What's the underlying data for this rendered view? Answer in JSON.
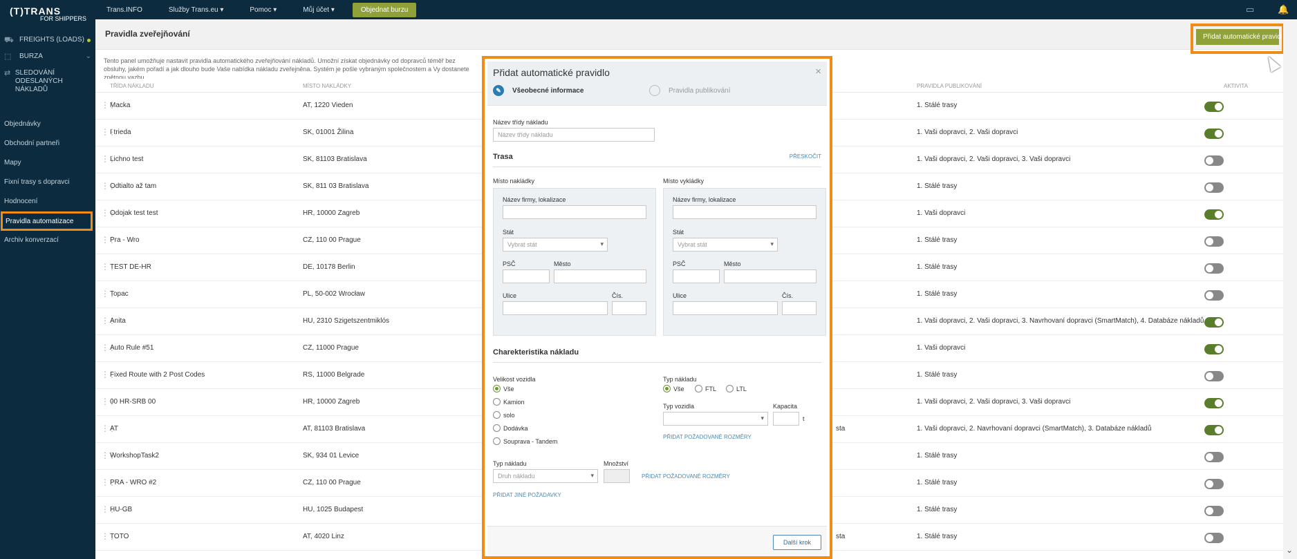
{
  "logo": {
    "line1": "(T)TRANS",
    "line2": "FOR SHIPPERS"
  },
  "sidebar": {
    "main": [
      {
        "label": "FREIGHTS (LOADS)",
        "icon": "freight-icon",
        "dot": true
      },
      {
        "label": "BURZA",
        "icon": "exchange-icon",
        "chevron": true
      },
      {
        "label": "SLEDOVÁNÍ ODESLANÝCH NÁKLADŮ",
        "icon": "tracking-icon"
      }
    ],
    "items": [
      {
        "label": "Objednávky"
      },
      {
        "label": "Obchodní partneři"
      },
      {
        "label": "Mapy"
      },
      {
        "label": "Fixní trasy s dopravci"
      },
      {
        "label": "Hodnocení"
      },
      {
        "label": "Pravidla automatizace",
        "active": true
      },
      {
        "label": "Archiv konverzací"
      }
    ]
  },
  "topbar": {
    "nav": [
      "Trans.INFO",
      "Služby Trans.eu ▾",
      "Pomoc ▾",
      "Můj účet ▾"
    ],
    "order_button": "Objednat burzu"
  },
  "page": {
    "title": "Pravidla zveřejňování",
    "add_button": "Přidat automatické pravidlo",
    "description": "Tento panel umožňuje nastavit pravidla automatického zveřejňování nákladů. Umožní získat objednávky od dopravců téměř bez obsluhy, jakém pořadí a jak dlouho bude Vaše nabídka nákladu zveřejněna. Systém je pošle vybraným společnostem a Vy dostanete zpětnou vazbu",
    "columns": {
      "class": "TŘÍDA NÁKLADU",
      "place": "MÍSTO NAKLÁDKY",
      "rules": "PRAVIDLA PUBLIKOVÁNÍ",
      "activity": "AKTIVITA"
    }
  },
  "rows": [
    {
      "name": "Macka",
      "place": "AT, 1220 Vieden",
      "rules": "1. Stálé trasy",
      "extra": "",
      "active": true
    },
    {
      "name": "I trieda",
      "place": "SK, 01001 Žilina",
      "rules": "1. Vaši dopravci, 2. Vaši dopravci",
      "extra": "",
      "active": true
    },
    {
      "name": "Lichno test",
      "place": "SK, 81103 Bratislava",
      "rules": "1. Vaši dopravci, 2. Vaši dopravci, 3. Vaši dopravci",
      "extra": "",
      "active": false
    },
    {
      "name": "Odtialto až tam",
      "place": "SK, 811 03 Bratislava",
      "rules": "1. Stálé trasy",
      "extra": "",
      "active": false
    },
    {
      "name": "Odojak test test",
      "place": "HR, 10000 Zagreb",
      "rules": "1. Vaši dopravci",
      "extra": "",
      "active": true
    },
    {
      "name": "Pra - Wro",
      "place": "CZ, 110 00 Prague",
      "rules": "1. Stálé trasy",
      "extra": "",
      "active": false
    },
    {
      "name": "TEST DE-HR",
      "place": "DE, 10178 Berlin",
      "rules": "1. Stálé trasy",
      "extra": "",
      "active": false
    },
    {
      "name": "Topac",
      "place": "PL, 50-002 Wrocław",
      "rules": "1. Stálé trasy",
      "extra": "",
      "active": false
    },
    {
      "name": "Anita",
      "place": "HU, 2310 Szigetszentmiklós",
      "rules": "1. Vaši dopravci, 2. Vaši dopravci, 3. Navrhovaní dopravci (SmartMatch), 4. Databáze nákladů",
      "extra": "",
      "active": true
    },
    {
      "name": "Auto Rule #51",
      "place": "CZ, 11000 Prague",
      "rules": "1. Vaši dopravci",
      "extra": "",
      "active": true
    },
    {
      "name": "Fixed Route with 2 Post Codes",
      "place": "RS, 11000 Belgrade",
      "rules": "1. Stálé trasy",
      "extra": "",
      "active": false
    },
    {
      "name": "00 HR-SRB 00",
      "place": "HR, 10000 Zagreb",
      "rules": "1. Vaši dopravci, 2. Vaši dopravci, 3. Vaši dopravci",
      "extra": "",
      "active": true
    },
    {
      "name": "AT",
      "place": "AT, 81103 Bratislava",
      "rules": "1. Vaši dopravci, 2. Navrhovaní dopravci (SmartMatch), 3. Databáze nákladů",
      "extra": "sta",
      "active": true
    },
    {
      "name": "WorkshopTask2",
      "place": "SK, 934 01 Levice",
      "rules": "1. Stálé trasy",
      "extra": "",
      "active": false
    },
    {
      "name": "PRA - WRO #2",
      "place": "CZ, 110 00 Prague",
      "rules": "1. Stálé trasy",
      "extra": "",
      "active": false
    },
    {
      "name": "HU-GB",
      "place": "HU, 1025 Budapest",
      "rules": "1. Stálé trasy",
      "extra": "",
      "active": false
    },
    {
      "name": "TOTO",
      "place": "AT, 4020 Linz",
      "rules": "1. Stálé trasy",
      "extra": "sta",
      "active": false
    }
  ],
  "modal": {
    "title": "Přidat automatické pravidlo",
    "close": "×",
    "step1": "Všeobecné informace",
    "step2": "Pravidla publikování",
    "class_label": "Název třídy nákladu",
    "class_placeholder": "Název třídy nákladu",
    "route_title": "Trasa",
    "skip": "PŘESKOČIT",
    "loading": {
      "title": "Místo nakládky",
      "company": "Název firmy, lokalizace",
      "country": "Stát",
      "country_placeholder": "Vybrat stát",
      "psc": "PSČ",
      "city": "Město",
      "street": "Ulice",
      "number": "Čís."
    },
    "unloading": {
      "title": "Místo vykládky",
      "company": "Název firmy, lokalizace",
      "country": "Stát",
      "country_placeholder": "Vybrat stát",
      "psc": "PSČ",
      "city": "Město",
      "street": "Ulice",
      "number": "Čís."
    },
    "char_title": "Charekteristika nákladu",
    "vehicle_size": "Velikost vozidla",
    "sizes": [
      "Vše",
      "Kamion",
      "solo",
      "Dodávka",
      "Souprava - Tandem"
    ],
    "load_type": "Typ nákladu",
    "load_types": [
      "Vše",
      "FTL",
      "LTL"
    ],
    "vehicle_type": "Typ vozidla",
    "capacity": "Kapacita",
    "capacity_unit": "t",
    "add_dims": "PŘIDAT POŽADOVANÉ ROZMĚRY",
    "cargo_type": "Typ nákladu",
    "cargo_placeholder": "Druh nákladu",
    "quantity": "Množství",
    "add_dims2": "PŘIDAT POŽADOVANÉ ROZMĚRY",
    "add_other": "PŘIDAT JINÉ POŽADAVKY",
    "next": "Další krok"
  }
}
